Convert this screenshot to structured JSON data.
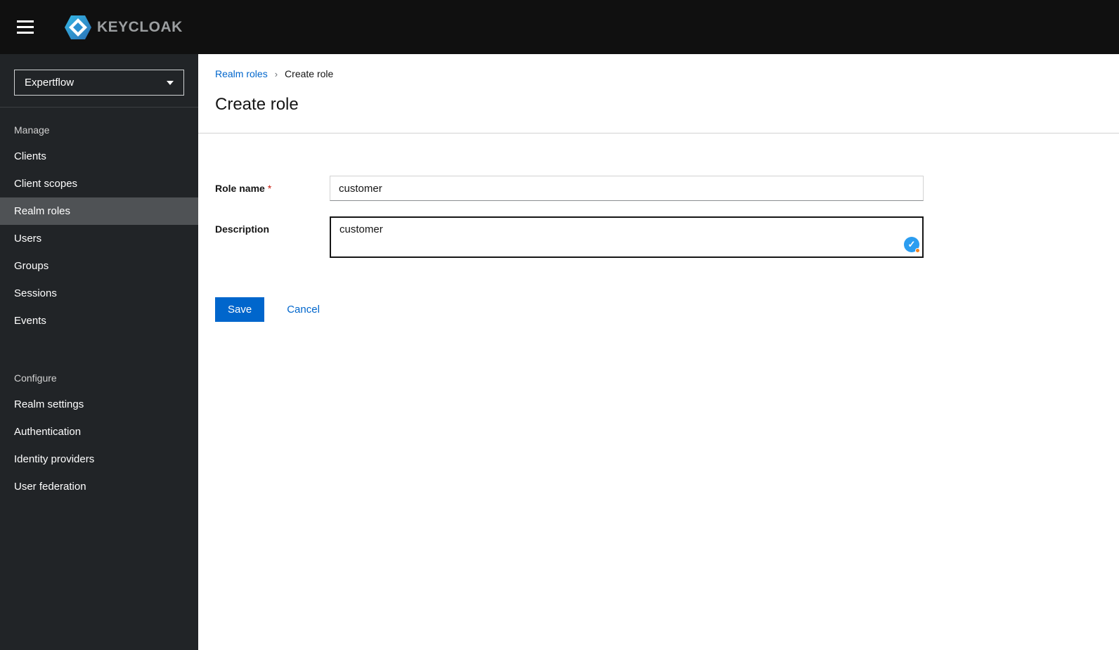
{
  "masthead": {
    "brand_text": "KEYCLOAK"
  },
  "sidebar": {
    "realm_selector": {
      "value": "Expertflow"
    },
    "groups": [
      {
        "label": "Manage",
        "items": [
          {
            "label": "Clients",
            "selected": false
          },
          {
            "label": "Client scopes",
            "selected": false
          },
          {
            "label": "Realm roles",
            "selected": true
          },
          {
            "label": "Users",
            "selected": false
          },
          {
            "label": "Groups",
            "selected": false
          },
          {
            "label": "Sessions",
            "selected": false
          },
          {
            "label": "Events",
            "selected": false
          }
        ]
      },
      {
        "label": "Configure",
        "items": [
          {
            "label": "Realm settings",
            "selected": false
          },
          {
            "label": "Authentication",
            "selected": false
          },
          {
            "label": "Identity providers",
            "selected": false
          },
          {
            "label": "User federation",
            "selected": false
          }
        ]
      }
    ]
  },
  "breadcrumb": {
    "link_label": "Realm roles",
    "separator": "›",
    "current_label": "Create role"
  },
  "page": {
    "title": "Create role"
  },
  "form": {
    "role_name": {
      "label": "Role name",
      "required_marker": "*",
      "value": "customer"
    },
    "description": {
      "label": "Description",
      "value": "customer"
    },
    "save_label": "Save",
    "cancel_label": "Cancel"
  },
  "colors": {
    "accent": "#0066cc",
    "danger": "#c9190b",
    "masthead_bg": "#101010",
    "sidebar_bg": "#212427",
    "selected_item_bg": "#4f5255"
  }
}
